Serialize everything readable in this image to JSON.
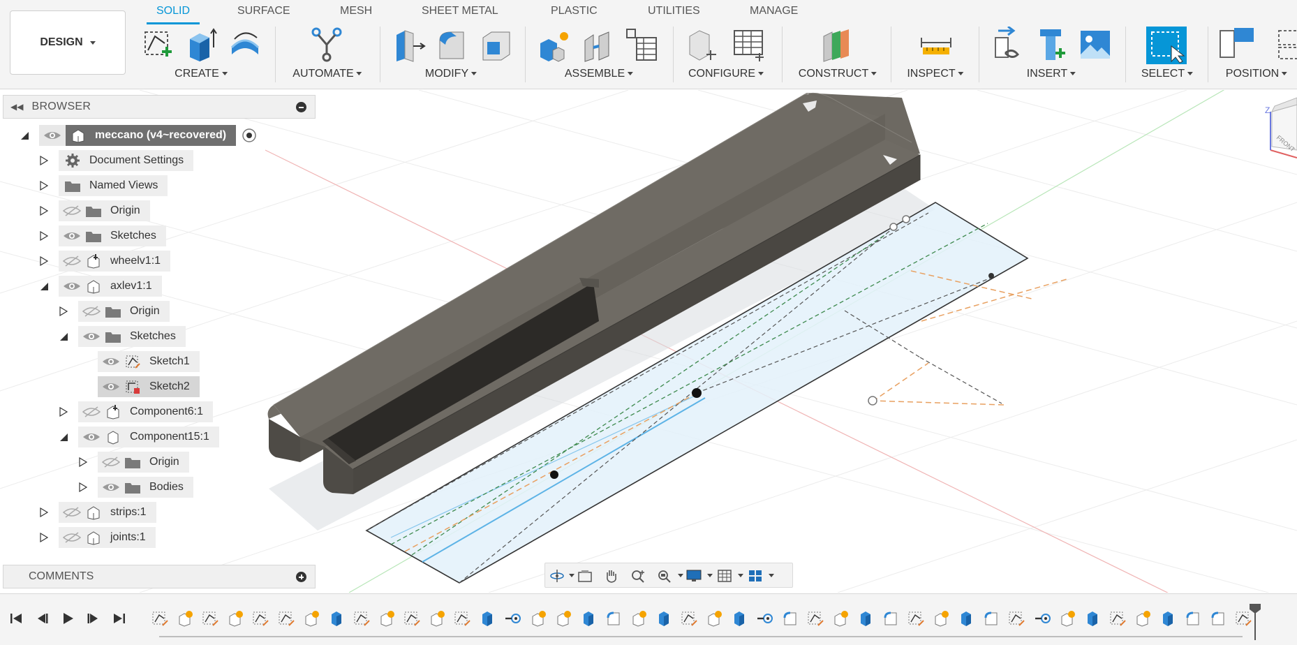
{
  "toolbar": {
    "workspace_label": "DESIGN",
    "tabs": [
      {
        "label": "SOLID",
        "active": true
      },
      {
        "label": "SURFACE"
      },
      {
        "label": "MESH"
      },
      {
        "label": "SHEET METAL"
      },
      {
        "label": "PLASTIC"
      },
      {
        "label": "UTILITIES"
      },
      {
        "label": "MANAGE"
      }
    ],
    "groups": [
      "CREATE",
      "AUTOMATE",
      "MODIFY",
      "ASSEMBLE",
      "CONFIGURE",
      "CONSTRUCT",
      "INSPECT",
      "INSERT",
      "SELECT",
      "POSITION"
    ]
  },
  "browser": {
    "title": "BROWSER",
    "items": [
      {
        "label": "meccano (v4~recovered)",
        "icon": "component-icon",
        "visible": true
      },
      {
        "label": "Document Settings",
        "icon": "gear-icon"
      },
      {
        "label": "Named Views",
        "icon": "folder-icon"
      },
      {
        "label": "Origin",
        "icon": "folder-icon",
        "visible": false
      },
      {
        "label": "Sketches",
        "icon": "folder-icon",
        "visible": true
      },
      {
        "label": "wheelv1:1",
        "icon": "component-grounded-icon",
        "visible": false
      },
      {
        "label": "axlev1:1",
        "icon": "component-icon",
        "visible": true
      },
      {
        "label": "Origin",
        "icon": "folder-icon",
        "visible": false
      },
      {
        "label": "Sketches",
        "icon": "folder-icon",
        "visible": true
      },
      {
        "label": "Sketch1",
        "icon": "sketch-icon",
        "visible": true
      },
      {
        "label": "Sketch2",
        "icon": "sketch-locked-icon",
        "visible": true
      },
      {
        "label": "Component6:1",
        "icon": "component-grounded-icon",
        "visible": false
      },
      {
        "label": "Component15:1",
        "icon": "body-icon",
        "visible": true
      },
      {
        "label": "Origin",
        "icon": "folder-icon",
        "visible": false
      },
      {
        "label": "Bodies",
        "icon": "folder-icon",
        "visible": true
      },
      {
        "label": "strips:1",
        "icon": "component-icon",
        "visible": false
      },
      {
        "label": "joints:1",
        "icon": "component-icon",
        "visible": false
      }
    ]
  },
  "comments": {
    "title": "COMMENTS"
  },
  "viewcube": {
    "axis_label": "Z",
    "face_label": "FRONT"
  },
  "colors": {
    "accent": "#0696d7",
    "model_body": "#6b6760",
    "sketch_plane": "#d6ecf8",
    "construction_orange": "#e8a060",
    "construction_green": "#3e8a4e"
  }
}
